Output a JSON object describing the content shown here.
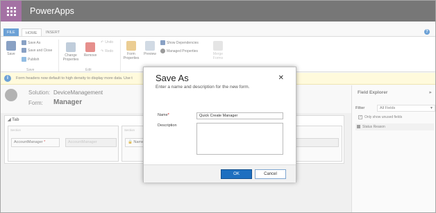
{
  "app": {
    "name": "PowerApps"
  },
  "ribbon": {
    "tabs": [
      "FILE",
      "HOME",
      "INSERT"
    ],
    "groups": {
      "save": {
        "label": "Save",
        "big_button": "Save",
        "items": [
          "Save As",
          "Save and Close",
          "Publish"
        ]
      },
      "edit": {
        "label": "Edit",
        "buttons": [
          "Change Properties",
          "Remove"
        ],
        "items": [
          "Undo",
          "Redo"
        ]
      },
      "misc": {
        "buttons": [
          "Form Properties",
          "Preview"
        ],
        "items": [
          "Show Dependencies",
          "Managed Properties"
        ],
        "merge": "Merge Forms"
      }
    },
    "help_icon": "help-icon"
  },
  "notification": {
    "text": "Form headers now default to high density to display more data. Use t"
  },
  "form_header": {
    "solution_label": "Solution:",
    "solution_value": "DeviceManagement",
    "form_label": "Form:",
    "form_value": "Manager"
  },
  "canvas": {
    "tab_label": "Tab",
    "section_label": "Section",
    "field_1": "AccountManager",
    "field_1_placeholder": "AccountManager",
    "field_2": "Name"
  },
  "field_explorer": {
    "title": "Field Explorer",
    "filter_label": "Filter",
    "filter_value": "All Fields",
    "checkbox_label": "Only show unused fields",
    "items": [
      "Status Reason"
    ]
  },
  "dialog": {
    "title": "Save As",
    "subtitle": "Enter a name and description for the new form.",
    "name_label": "Name",
    "name_value": "Quick Create Manager",
    "description_label": "Description",
    "ok": "OK",
    "cancel": "Cancel"
  }
}
